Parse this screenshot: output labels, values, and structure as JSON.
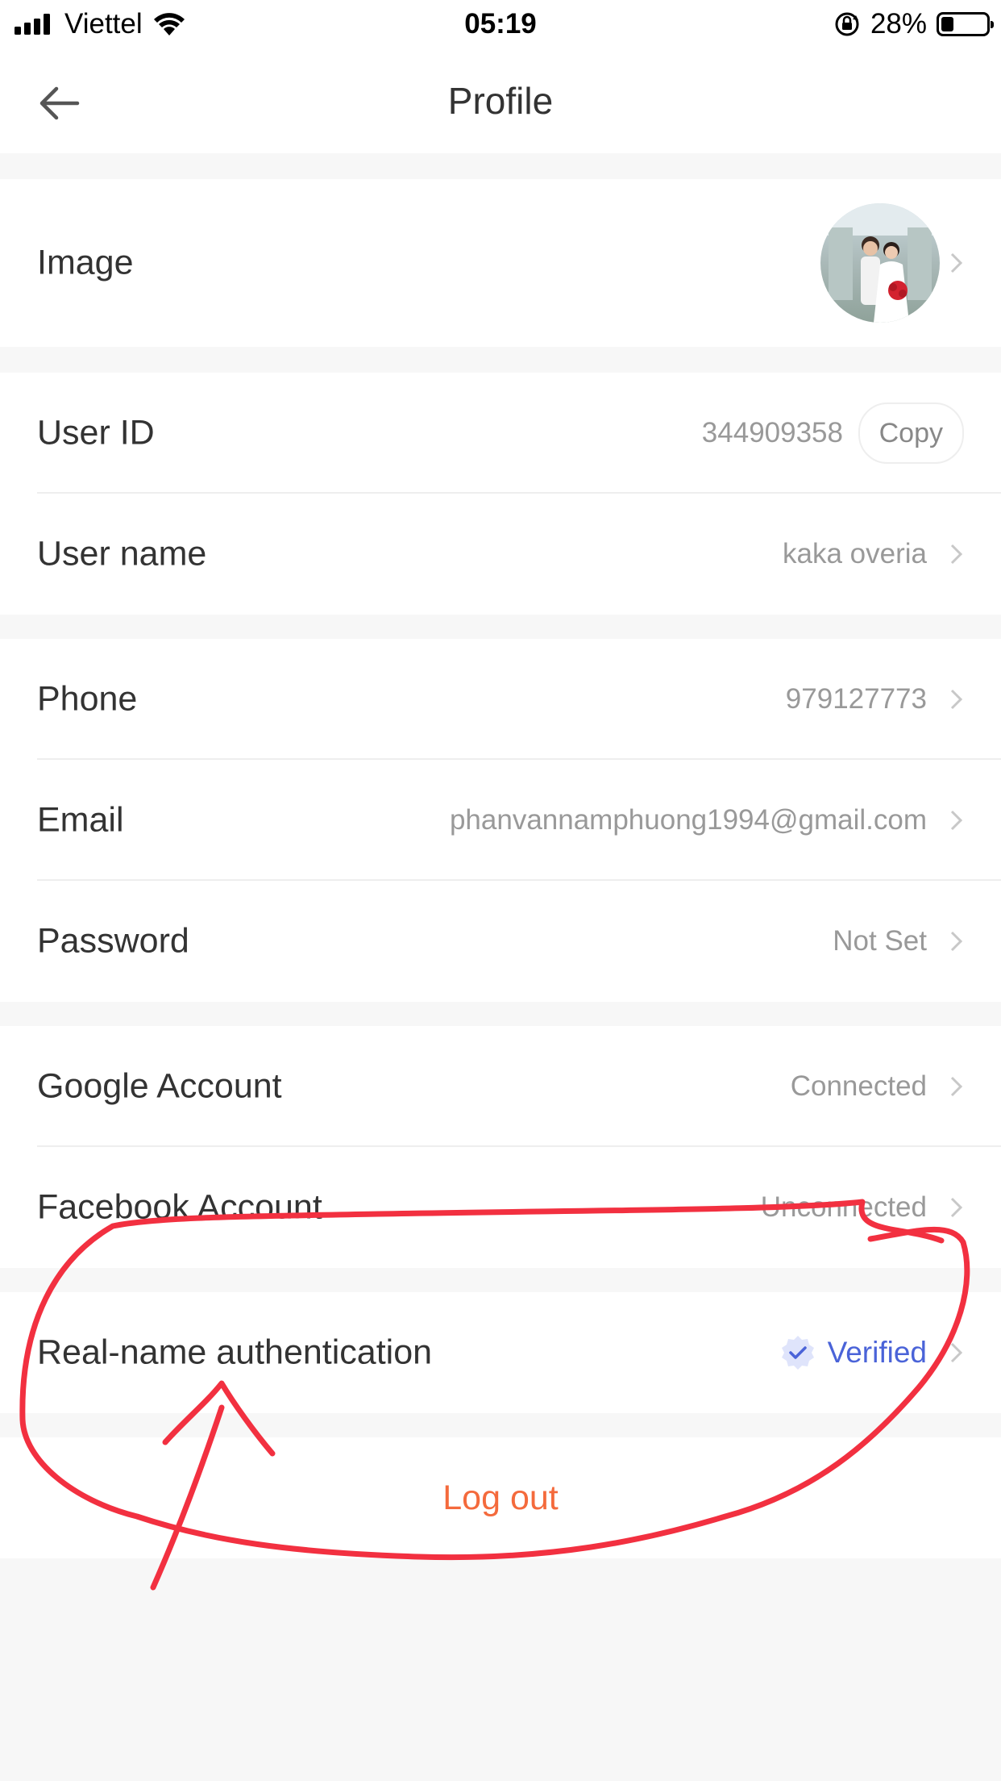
{
  "status_bar": {
    "carrier": "Viettel",
    "time": "05:19",
    "battery_percent": "28%",
    "battery_level": 0.28,
    "icons": [
      "signal-icon",
      "wifi-icon",
      "rotation-lock-icon",
      "battery-icon"
    ]
  },
  "header": {
    "title": "Profile",
    "back_icon": "back-arrow-icon"
  },
  "profile": {
    "image_label": "Image",
    "user_id_label": "User ID",
    "user_id_value": "344909358",
    "copy_label": "Copy",
    "user_name_label": "User name",
    "user_name_value": "kaka overia",
    "phone_label": "Phone",
    "phone_value": "979127773",
    "email_label": "Email",
    "email_value": "phanvannamphuong1994@gmail.com",
    "password_label": "Password",
    "password_value": "Not Set",
    "google_label": "Google Account",
    "google_value": "Connected",
    "facebook_label": "Facebook Account",
    "facebook_value": "Unconnected",
    "realname_label": "Real-name authentication",
    "realname_value": "Verified",
    "logout_label": "Log out"
  },
  "colors": {
    "accent_logout": "#f46a3c",
    "verified_blue": "#4a63d8",
    "annotation_red": "#f23040",
    "background": "#f7f7f7"
  }
}
